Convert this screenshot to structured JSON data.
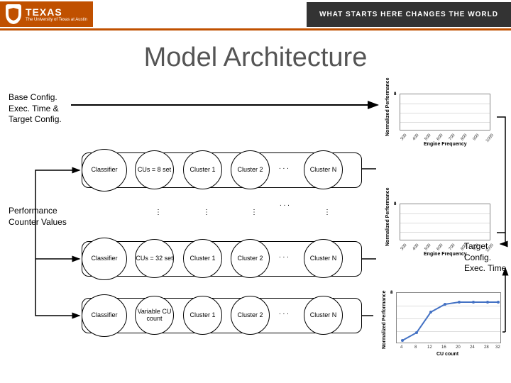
{
  "header": {
    "logo_big": "TEXAS",
    "logo_small": "The University of Texas at Austin",
    "tagline": "WHAT STARTS HERE CHANGES THE WORLD"
  },
  "title": "Model Architecture",
  "labels": {
    "base_config": "Base Config. Exec. Time & Target Config.",
    "perf_counter": "Performance Counter Values",
    "target_config": "Target Config. Exec. Time"
  },
  "nodes": {
    "classifier": "Classifier",
    "cus8": "CUs = 8 set",
    "cus32": "CUs = 32 set",
    "variable": "Variable CU count",
    "cluster1": "Cluster 1",
    "cluster2": "Cluster 2",
    "clusterN": "Cluster N",
    "dots": ". . .",
    "vdots": "⋮"
  },
  "chart_data": [
    {
      "type": "line",
      "title": "",
      "xlabel": "Engine Frequency",
      "ylabel": "Normalized Performance",
      "x": [
        300,
        400,
        500,
        600,
        700,
        800,
        900,
        1000
      ],
      "values": [
        0,
        0,
        0,
        0,
        0,
        0,
        0,
        0
      ],
      "ylim": [
        0,
        4
      ],
      "yticks": [
        0,
        1,
        2,
        3,
        4
      ]
    },
    {
      "type": "line",
      "title": "",
      "xlabel": "Engine Frequency",
      "ylabel": "Normalized Performance",
      "x": [
        300,
        400,
        500,
        600,
        700,
        800,
        900,
        1000
      ],
      "values": [
        0,
        0,
        0,
        0,
        0,
        0,
        0,
        0
      ],
      "ylim": [
        0,
        4
      ],
      "yticks": [
        0,
        1,
        2,
        3,
        4
      ]
    },
    {
      "type": "line",
      "title": "",
      "xlabel": "CU count",
      "ylabel": "Normalized Performance",
      "x": [
        4,
        8,
        12,
        16,
        20,
        24,
        28,
        32
      ],
      "values": [
        0.3,
        0.9,
        2.5,
        3.1,
        3.3,
        3.3,
        3.3,
        3.3
      ],
      "ylim": [
        0,
        4
      ],
      "yticks": [
        0,
        1,
        2,
        3,
        4
      ]
    }
  ]
}
